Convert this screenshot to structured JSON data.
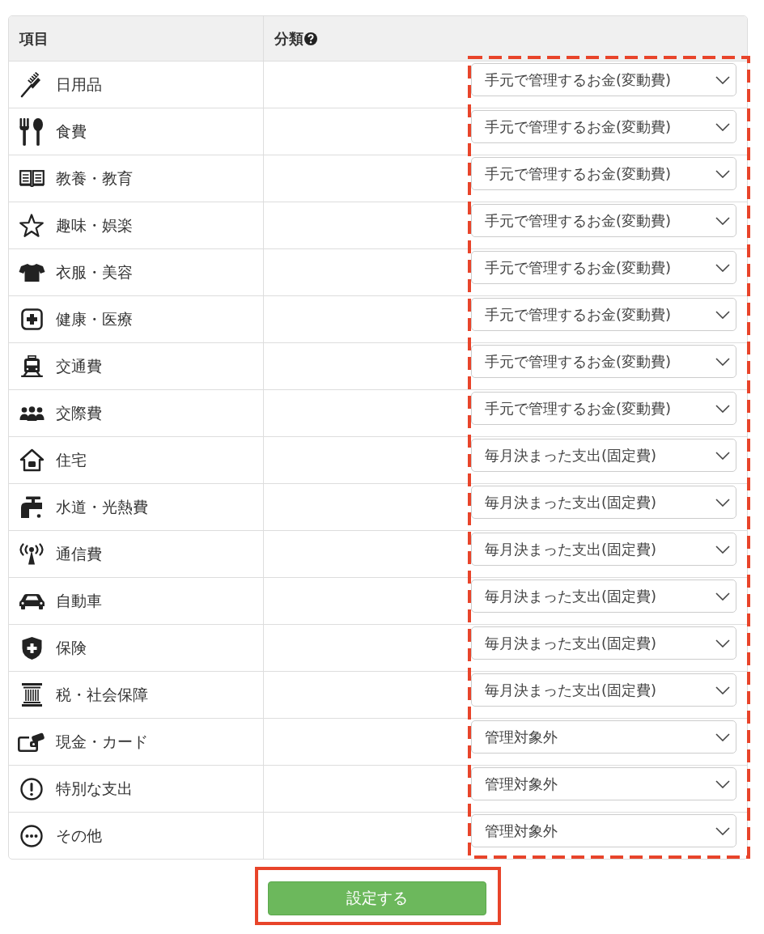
{
  "table": {
    "columns": [
      {
        "label": "項目",
        "help": false
      },
      {
        "label": "分類",
        "help": true
      }
    ],
    "rows": [
      {
        "label": "日用品",
        "category": "手元で管理するお金(変動費)"
      },
      {
        "label": "食費",
        "category": "手元で管理するお金(変動費)"
      },
      {
        "label": "教養・教育",
        "category": "手元で管理するお金(変動費)"
      },
      {
        "label": "趣味・娯楽",
        "category": "手元で管理するお金(変動費)"
      },
      {
        "label": "衣服・美容",
        "category": "手元で管理するお金(変動費)"
      },
      {
        "label": "健康・医療",
        "category": "手元で管理するお金(変動費)"
      },
      {
        "label": "交通費",
        "category": "手元で管理するお金(変動費)"
      },
      {
        "label": "交際費",
        "category": "手元で管理するお金(変動費)"
      },
      {
        "label": "住宅",
        "category": "毎月決まった支出(固定費)"
      },
      {
        "label": "水道・光熱費",
        "category": "毎月決まった支出(固定費)"
      },
      {
        "label": "通信費",
        "category": "毎月決まった支出(固定費)"
      },
      {
        "label": "自動車",
        "category": "毎月決まった支出(固定費)"
      },
      {
        "label": "保険",
        "category": "毎月決まった支出(固定費)"
      },
      {
        "label": "税・社会保障",
        "category": "毎月決まった支出(固定費)"
      },
      {
        "label": "現金・カード",
        "category": "管理対象外"
      },
      {
        "label": "特別な支出",
        "category": "管理対象外"
      },
      {
        "label": "その他",
        "category": "管理対象外"
      }
    ]
  },
  "submit_button": {
    "label": "設定する"
  }
}
